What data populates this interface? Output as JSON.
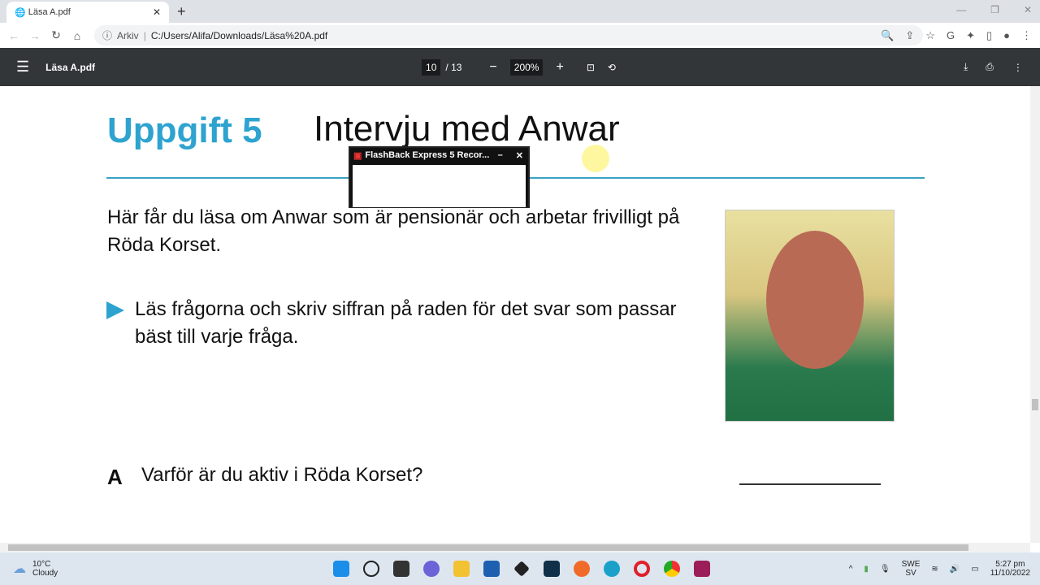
{
  "browser": {
    "tab_title": "Läsa A.pdf",
    "address_prefix": "Arkiv",
    "url": "C:/Users/Alifa/Downloads/Läsa%20A.pdf"
  },
  "pdf": {
    "title": "Läsa A.pdf",
    "current_page": "10",
    "total_pages": "/ 13",
    "zoom": "200%"
  },
  "document": {
    "heading_number": "Uppgift 5",
    "heading_title": "Intervju med Anwar",
    "intro": "Här får du läsa om Anwar som är pensionär och arbetar frivilligt på Röda Korset.",
    "instruction": "Läs frågorna och skriv siffran på raden för det svar som passar bäst till varje fråga.",
    "question_letter": "A",
    "question": "Varför är du aktiv i Röda Korset?"
  },
  "overlay": {
    "title": "FlashBack Express 5 Recor..."
  },
  "taskbar": {
    "temperature": "10°C",
    "weather": "Cloudy",
    "lang_top": "SWE",
    "lang_bottom": "SV",
    "time": "5:27 pm",
    "date": "11/10/2022"
  }
}
